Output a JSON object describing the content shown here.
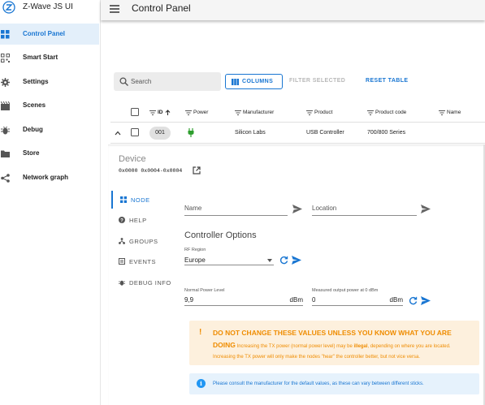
{
  "app": {
    "title": "Z-Wave JS UI",
    "page_title": "Control Panel"
  },
  "sidebar": {
    "items": [
      {
        "label": "Control Panel",
        "icon": "grid-icon",
        "active": true
      },
      {
        "label": "Smart Start",
        "icon": "qr-icon"
      },
      {
        "label": "Settings",
        "icon": "gear-icon"
      },
      {
        "label": "Scenes",
        "icon": "scenes-icon"
      },
      {
        "label": "Debug",
        "icon": "bug-icon"
      },
      {
        "label": "Store",
        "icon": "folder-icon"
      },
      {
        "label": "Network graph",
        "icon": "share-icon"
      }
    ]
  },
  "toolbar": {
    "search_placeholder": "Search",
    "columns_label": "COLUMNS",
    "filter_selected_label": "FILTER SELECTED",
    "reset_table_label": "RESET TABLE"
  },
  "table": {
    "headers": [
      "ID",
      "Power",
      "Manufacturer",
      "Product",
      "Product code",
      "Name"
    ],
    "rows": [
      {
        "id": "001",
        "power": "plug-icon",
        "manufacturer": "Silicon Labs",
        "product": "USB Controller",
        "product_code": "700/800 Series",
        "name": ""
      }
    ]
  },
  "device": {
    "title": "Device",
    "code": "0x0000 0x0004-0x0004"
  },
  "tabs": [
    {
      "label": "NODE",
      "icon": "grid-icon",
      "active": true
    },
    {
      "label": "HELP",
      "icon": "help-icon"
    },
    {
      "label": "GROUPS",
      "icon": "groups-icon"
    },
    {
      "label": "EVENTS",
      "icon": "events-icon"
    },
    {
      "label": "DEBUG INFO",
      "icon": "bug-icon"
    }
  ],
  "node": {
    "name_label": "Name",
    "location_label": "Location",
    "controller_options_title": "Controller Options",
    "rf_region_label": "RF Region",
    "rf_region_value": "Europe",
    "normal_power_label": "Normal Power Level",
    "normal_power_value": "9,9",
    "normal_power_unit": "dBm",
    "measured_power_label": "Measured output power at 0 dBm",
    "measured_power_value": "0",
    "measured_power_unit": "dBm"
  },
  "alerts": {
    "warning_title": "DO NOT CHANGE THESE VALUES UNLESS YOU KNOW WHAT YOU ARE DOING",
    "warning_part1": " Increasing the TX power (normal power level) may be ",
    "warning_illegal": "illegal",
    "warning_part2": ", depending on where you are located. Increasing the TX power will only make the nodes \"hear\" the controller better, but not vice versa.",
    "info_text": "Please consult the manufacturer for the default values, as these can vary between different sticks."
  },
  "colors": {
    "primary": "#1976d2",
    "warning": "#ef8c00",
    "plug_green": "#2e9e2e"
  }
}
